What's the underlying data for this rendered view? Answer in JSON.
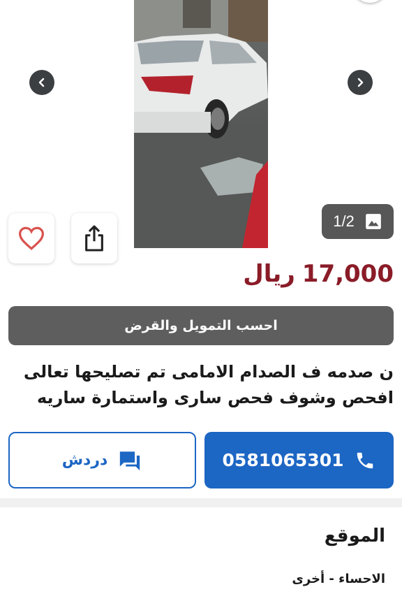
{
  "gallery": {
    "photo_alt": "car photo",
    "counter": "1/2",
    "counter_icon": "image-icon",
    "prev_icon": "chevron-left-icon",
    "next_icon": "chevron-right-icon"
  },
  "actions": {
    "favorite_icon": "heart-icon",
    "share_icon": "share-icon"
  },
  "listing": {
    "price": "17,000",
    "currency": "ريال",
    "finance_label": "احسب التمويل والقرض",
    "description": "ن صدمه ف الصدام الامامى تم تصليحها تعالى افحص وشوف فحص سارى واستمارة ساريه"
  },
  "contact": {
    "chat_label": "دردش",
    "chat_icon": "chat-icon",
    "phone": "0581065301",
    "phone_icon": "phone-icon"
  },
  "location_section": {
    "title": "الموقع",
    "value": "الاحساء - أخرى"
  },
  "colors": {
    "price": "#8a1c28",
    "primary": "#1c66c4",
    "finance_button": "#5e5e5e"
  }
}
